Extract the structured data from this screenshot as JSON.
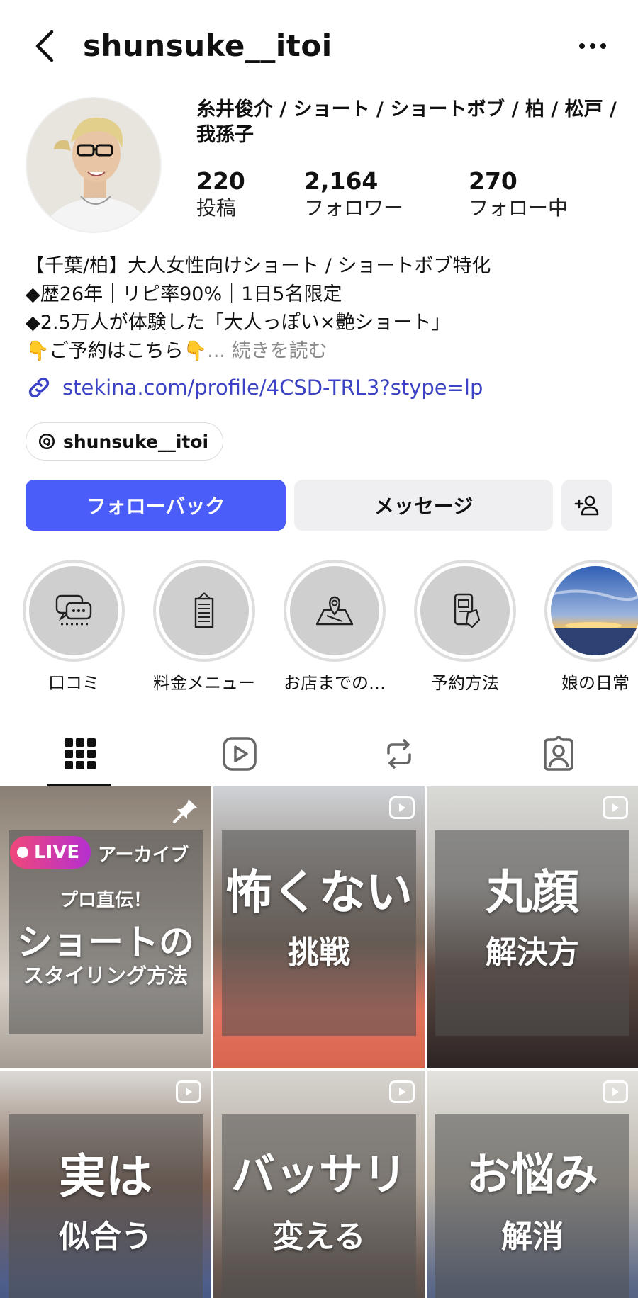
{
  "header": {
    "username": "shunsuke__itoi"
  },
  "profile": {
    "display_name": "糸井俊介 / ショート / ショートボブ / 柏 / 松戸 / 我孫子",
    "stats": [
      {
        "value": "220",
        "label": "投稿"
      },
      {
        "value": "2,164",
        "label": "フォロワー"
      },
      {
        "value": "270",
        "label": "フォロー中"
      }
    ],
    "bio_lines": [
      "【千葉/柏】大人女性向けショート / ショートボブ特化",
      "◆歴26年｜リピ率90%｜1日5名限定",
      "◆2.5万人が体験した「大人っぽい×艶ショート」"
    ],
    "bio_last_line": "👇ご予約はこちら👇",
    "read_more_prefix": "...",
    "read_more": "続きを読む",
    "link": "stekina.com/profile/4CSD-TRL3?stype=lp",
    "threads_handle": "shunsuke__itoi"
  },
  "actions": {
    "follow_back": "フォローバック",
    "message": "メッセージ"
  },
  "highlights": [
    {
      "label": "口コミ",
      "icon": "speech-bubble-icon"
    },
    {
      "label": "料金メニュー",
      "icon": "price-list-icon"
    },
    {
      "label": "お店までの…",
      "icon": "map-pin-icon"
    },
    {
      "label": "予約方法",
      "icon": "phone-booking-icon"
    },
    {
      "label": "娘の日常",
      "icon": "sunset-photo"
    }
  ],
  "tabs": [
    {
      "name": "grid-icon",
      "active": true
    },
    {
      "name": "reels-icon",
      "active": false
    },
    {
      "name": "repost-icon",
      "active": false
    },
    {
      "name": "tagged-icon",
      "active": false
    }
  ],
  "posts": [
    {
      "line1": "プロ直伝！",
      "line2": "ショートの",
      "line3": "スタイリング方法",
      "live_label": "LIVE",
      "archive_label": "アーカイブ",
      "pinned": true
    },
    {
      "line1": "怖くない",
      "line2": "挑戦"
    },
    {
      "line1": "丸顔",
      "line2": "解決方"
    },
    {
      "line1": "実は",
      "line2": "似合う"
    },
    {
      "line1": "バッサリ",
      "line2": "変える"
    },
    {
      "line1": "お悩み",
      "line2": "解消"
    }
  ],
  "colors": {
    "accent": "#4a5df9",
    "link": "#3b43c4",
    "live_gradient_start": "#f0487a",
    "live_gradient_end": "#b52fd0"
  }
}
